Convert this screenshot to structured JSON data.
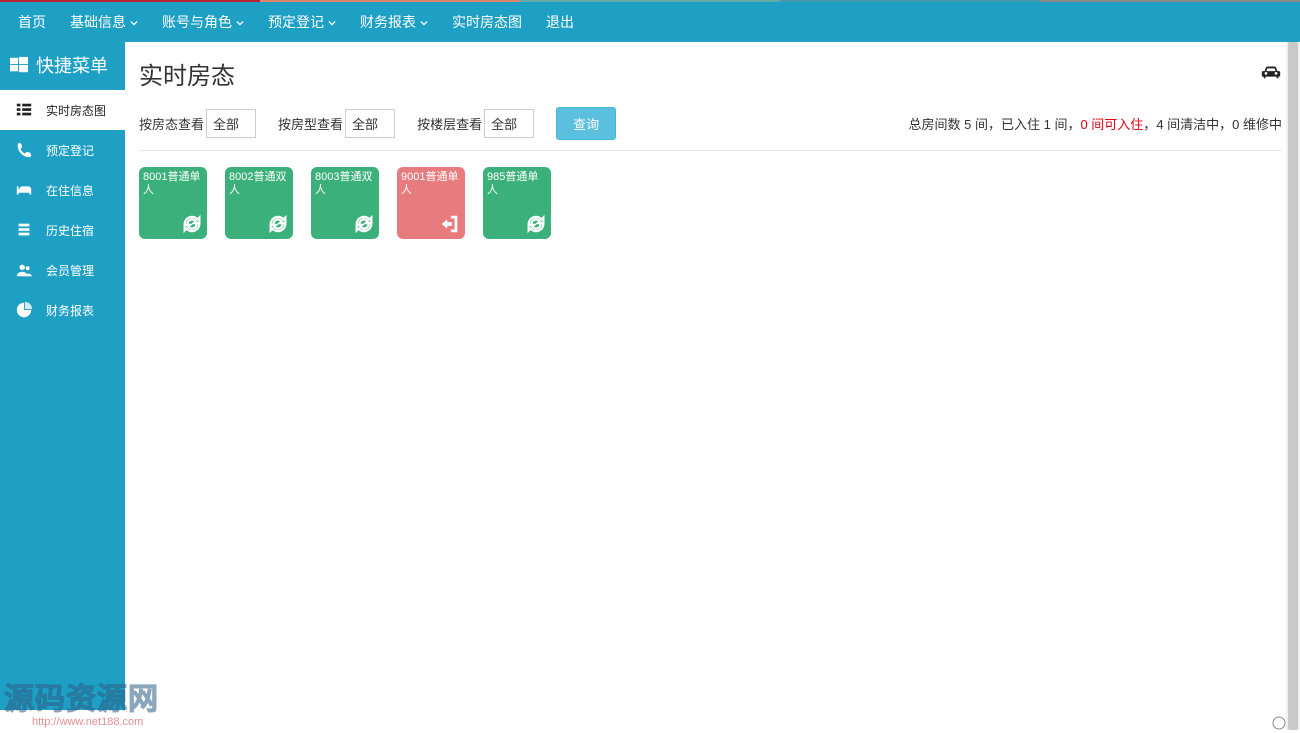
{
  "topnav": {
    "items": [
      {
        "label": "首页",
        "has_dropdown": false
      },
      {
        "label": "基础信息",
        "has_dropdown": true
      },
      {
        "label": "账号与角色",
        "has_dropdown": true
      },
      {
        "label": "预定登记",
        "has_dropdown": true
      },
      {
        "label": "财务报表",
        "has_dropdown": true
      },
      {
        "label": "实时房态图",
        "has_dropdown": false
      },
      {
        "label": "退出",
        "has_dropdown": false
      }
    ]
  },
  "sidebar": {
    "header": "快捷菜单",
    "items": [
      {
        "label": "实时房态图",
        "icon": "list-icon",
        "active": true
      },
      {
        "label": "预定登记",
        "icon": "phone-icon",
        "active": false
      },
      {
        "label": "在住信息",
        "icon": "bed-icon",
        "active": false
      },
      {
        "label": "历史住宿",
        "icon": "stack-icon",
        "active": false
      },
      {
        "label": "会员管理",
        "icon": "user-icon",
        "active": false
      },
      {
        "label": "财务报表",
        "icon": "pie-icon",
        "active": false
      }
    ]
  },
  "main": {
    "title": "实时房态",
    "filters": {
      "by_status_label": "按房态查看",
      "by_type_label": "按房型查看",
      "by_floor_label": "按楼层查看",
      "all_option": "全部",
      "query_button": "查询"
    },
    "stats": {
      "prefix_total": "总房间数 ",
      "total_value": "5",
      "total_unit": " 间，",
      "prefix_checked": "已入住 ",
      "checked_value": "1",
      "checked_unit": " 间，",
      "available_text": "0 间可入住",
      "suffix1": "，",
      "prefix_clean": "4 间清洁中，",
      "prefix_repair": "0 维修中"
    },
    "rooms": [
      {
        "label": "8001普通单人",
        "status": "cleaning",
        "color": "green",
        "icon": "refresh-icon"
      },
      {
        "label": "8002普通双人",
        "status": "cleaning",
        "color": "green",
        "icon": "refresh-icon"
      },
      {
        "label": "8003普通双人",
        "status": "cleaning",
        "color": "green",
        "icon": "refresh-icon"
      },
      {
        "label": "9001普通单人",
        "status": "occupied",
        "color": "red",
        "icon": "enter-icon"
      },
      {
        "label": "985普通单人",
        "status": "cleaning",
        "color": "green",
        "icon": "refresh-icon"
      }
    ]
  },
  "watermark": {
    "title": "源码资源网",
    "url": "http://www.net188.com"
  },
  "colors": {
    "brand": "#1e9fc4",
    "button": "#5bc0de",
    "room_green": "#3bb07a",
    "room_red": "#e77b7e",
    "alert_red": "#e60012"
  }
}
